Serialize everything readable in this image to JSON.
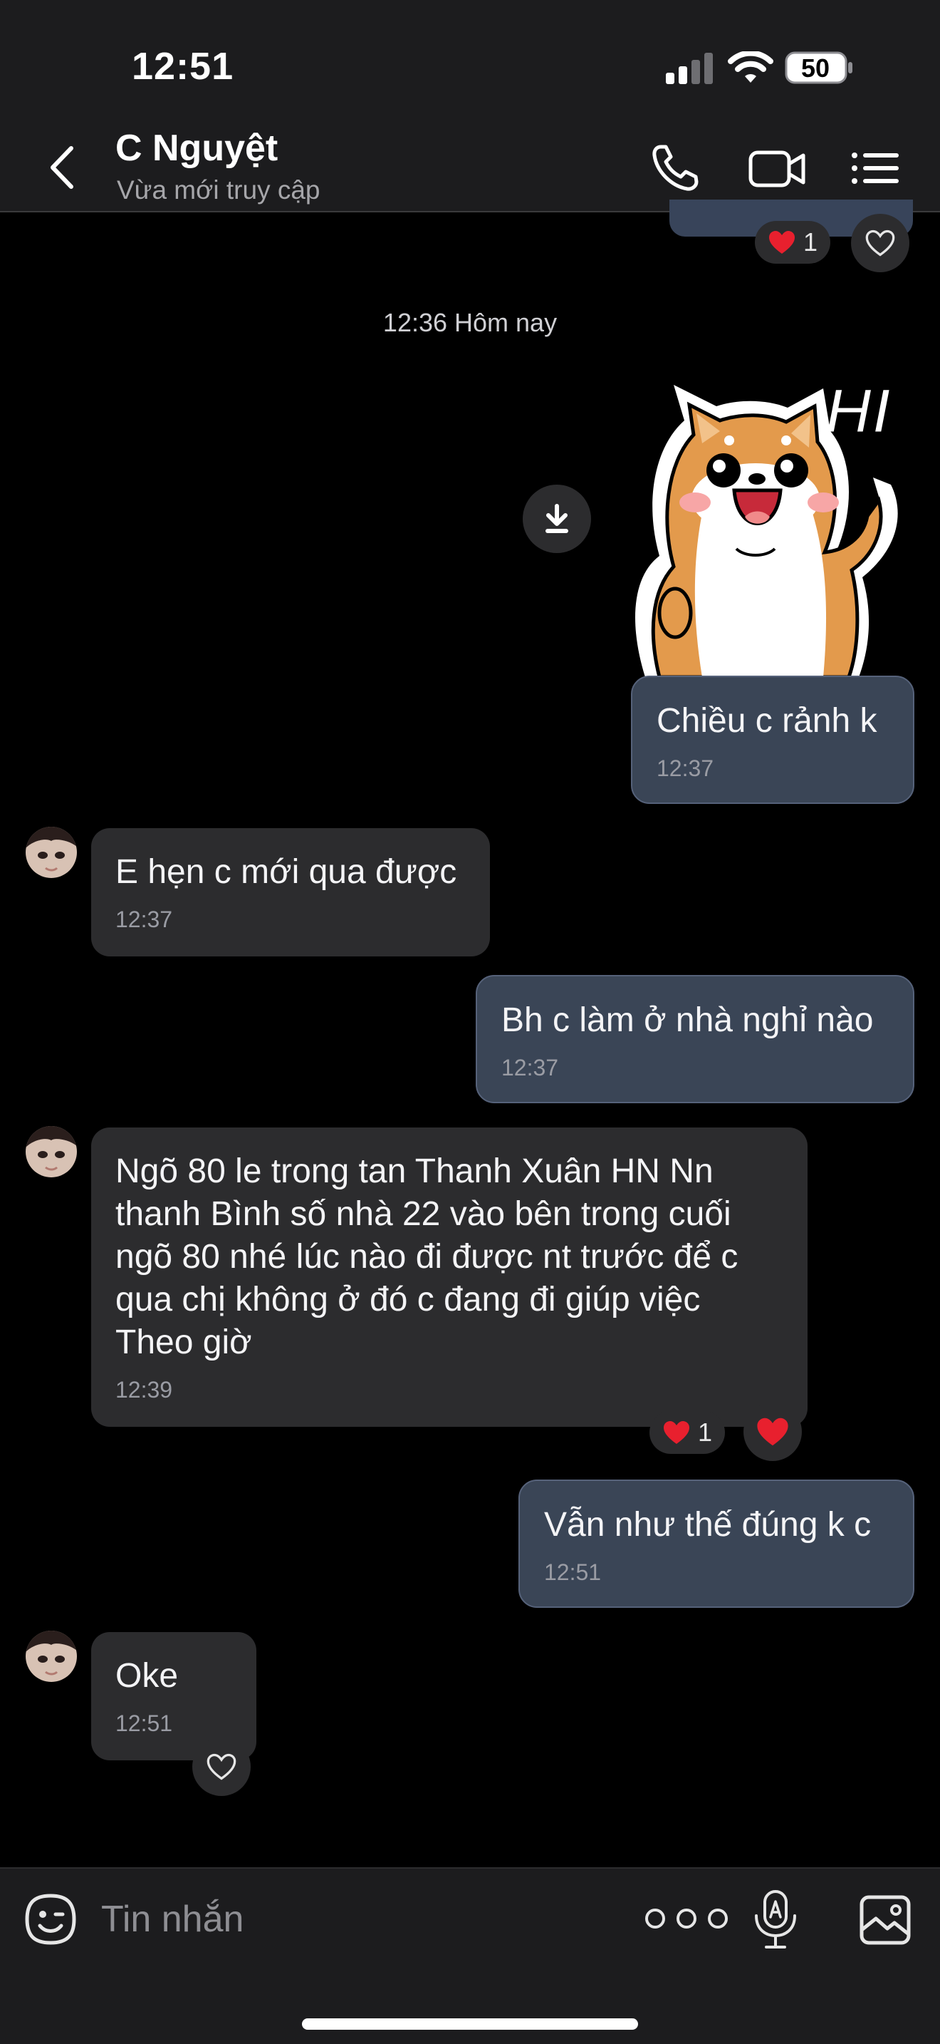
{
  "status_bar": {
    "time": "12:51",
    "battery": "50"
  },
  "header": {
    "contact_name": "C Nguyệt",
    "contact_status": "Vừa mới truy cập"
  },
  "chat": {
    "top_reaction_count": "1",
    "date_separator": "12:36 Hôm nay",
    "sticker_text": "HI",
    "messages": [
      {
        "direction": "out",
        "text": "Chiều c rảnh k",
        "time": "12:37"
      },
      {
        "direction": "in",
        "text": "E hẹn c mới qua được",
        "time": "12:37"
      },
      {
        "direction": "out",
        "text": "Bh c làm ở nhà nghỉ nào",
        "time": "12:37"
      },
      {
        "direction": "in",
        "text": "Ngõ 80 le trong tan Thanh Xuân HN Nn\nthanh Bình số nhà 22 vào bên trong cuối\nngõ 80 nhé lúc nào đi được nt trước để c\nqua chị không ở đó c đang đi giúp việc\nTheo giờ",
        "time": "12:39",
        "reaction_count": "1"
      },
      {
        "direction": "out",
        "text": "Vẫn như thế đúng k c",
        "time": "12:51"
      },
      {
        "direction": "in",
        "text": "Oke",
        "time": "12:51"
      }
    ]
  },
  "input_bar": {
    "placeholder": "Tin nhắn"
  },
  "colors": {
    "background": "#000000",
    "outgoing_bubble": "#3a4556",
    "incoming_bubble": "#2c2c2e",
    "heart": "#e8202e"
  }
}
